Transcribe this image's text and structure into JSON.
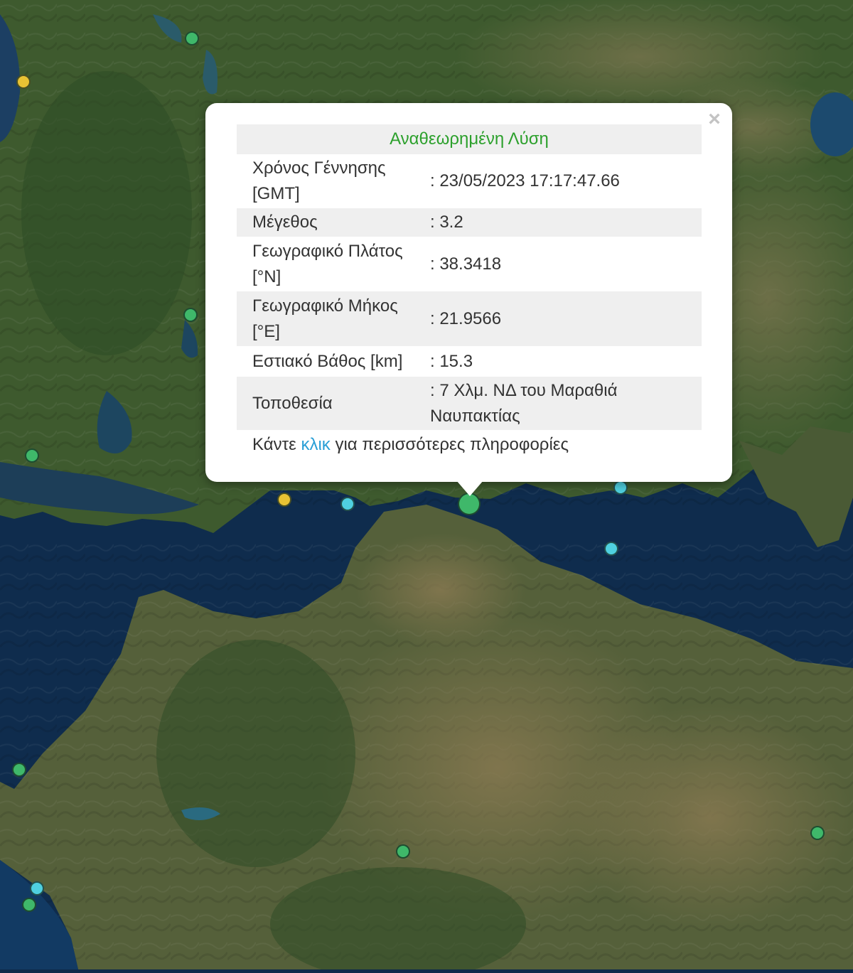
{
  "popup": {
    "header": "Αναθεωρημένη Λύση",
    "close_symbol": "×",
    "rows": [
      {
        "label_line1": "Χρόνος Γέννησης",
        "label_line2": "[GMT]",
        "value_line1": ": 23/05/2023 17:17:47.66",
        "value_line2": ""
      },
      {
        "label_line1": "Μέγεθος",
        "label_line2": "",
        "value_line1": ": 3.2",
        "value_line2": ""
      },
      {
        "label_line1": "Γεωγραφικό Πλάτος",
        "label_line2": "[°N]",
        "value_line1": ": 38.3418",
        "value_line2": ""
      },
      {
        "label_line1": "Γεωγραφικό Μήκος",
        "label_line2": "[°E]",
        "value_line1": ": 21.9566",
        "value_line2": ""
      },
      {
        "label_line1": "Εστιακό Βάθος [km]",
        "label_line2": "",
        "value_line1": ": 15.3",
        "value_line2": ""
      },
      {
        "label_line1": "Τοποθεσία",
        "label_line2": "",
        "value_line1": ": 7 Χλμ. ΝΔ του Μαραθιά",
        "value_line2": "Ναυπακτίας"
      }
    ],
    "footer_before": "Κάντε",
    "footer_link": "κλικ",
    "footer_after": "για περισσότερες πληροφορίες"
  },
  "marker_colors": {
    "green": "#3fb86a",
    "yellow": "#e8c234",
    "cyan": "#4fd0e0"
  },
  "markers": [
    {
      "color": "green",
      "size": "small"
    },
    {
      "color": "yellow",
      "size": "small"
    },
    {
      "color": "green",
      "size": "small"
    },
    {
      "color": "green",
      "size": "small"
    },
    {
      "color": "yellow",
      "size": "small"
    },
    {
      "color": "cyan",
      "size": "small"
    },
    {
      "color": "green",
      "size": "large",
      "selected": true
    },
    {
      "color": "cyan",
      "size": "small"
    },
    {
      "color": "cyan",
      "size": "small"
    },
    {
      "color": "green",
      "size": "small"
    },
    {
      "color": "green",
      "size": "small"
    },
    {
      "color": "green",
      "size": "small"
    },
    {
      "color": "cyan",
      "size": "small"
    },
    {
      "color": "green",
      "size": "small"
    }
  ]
}
